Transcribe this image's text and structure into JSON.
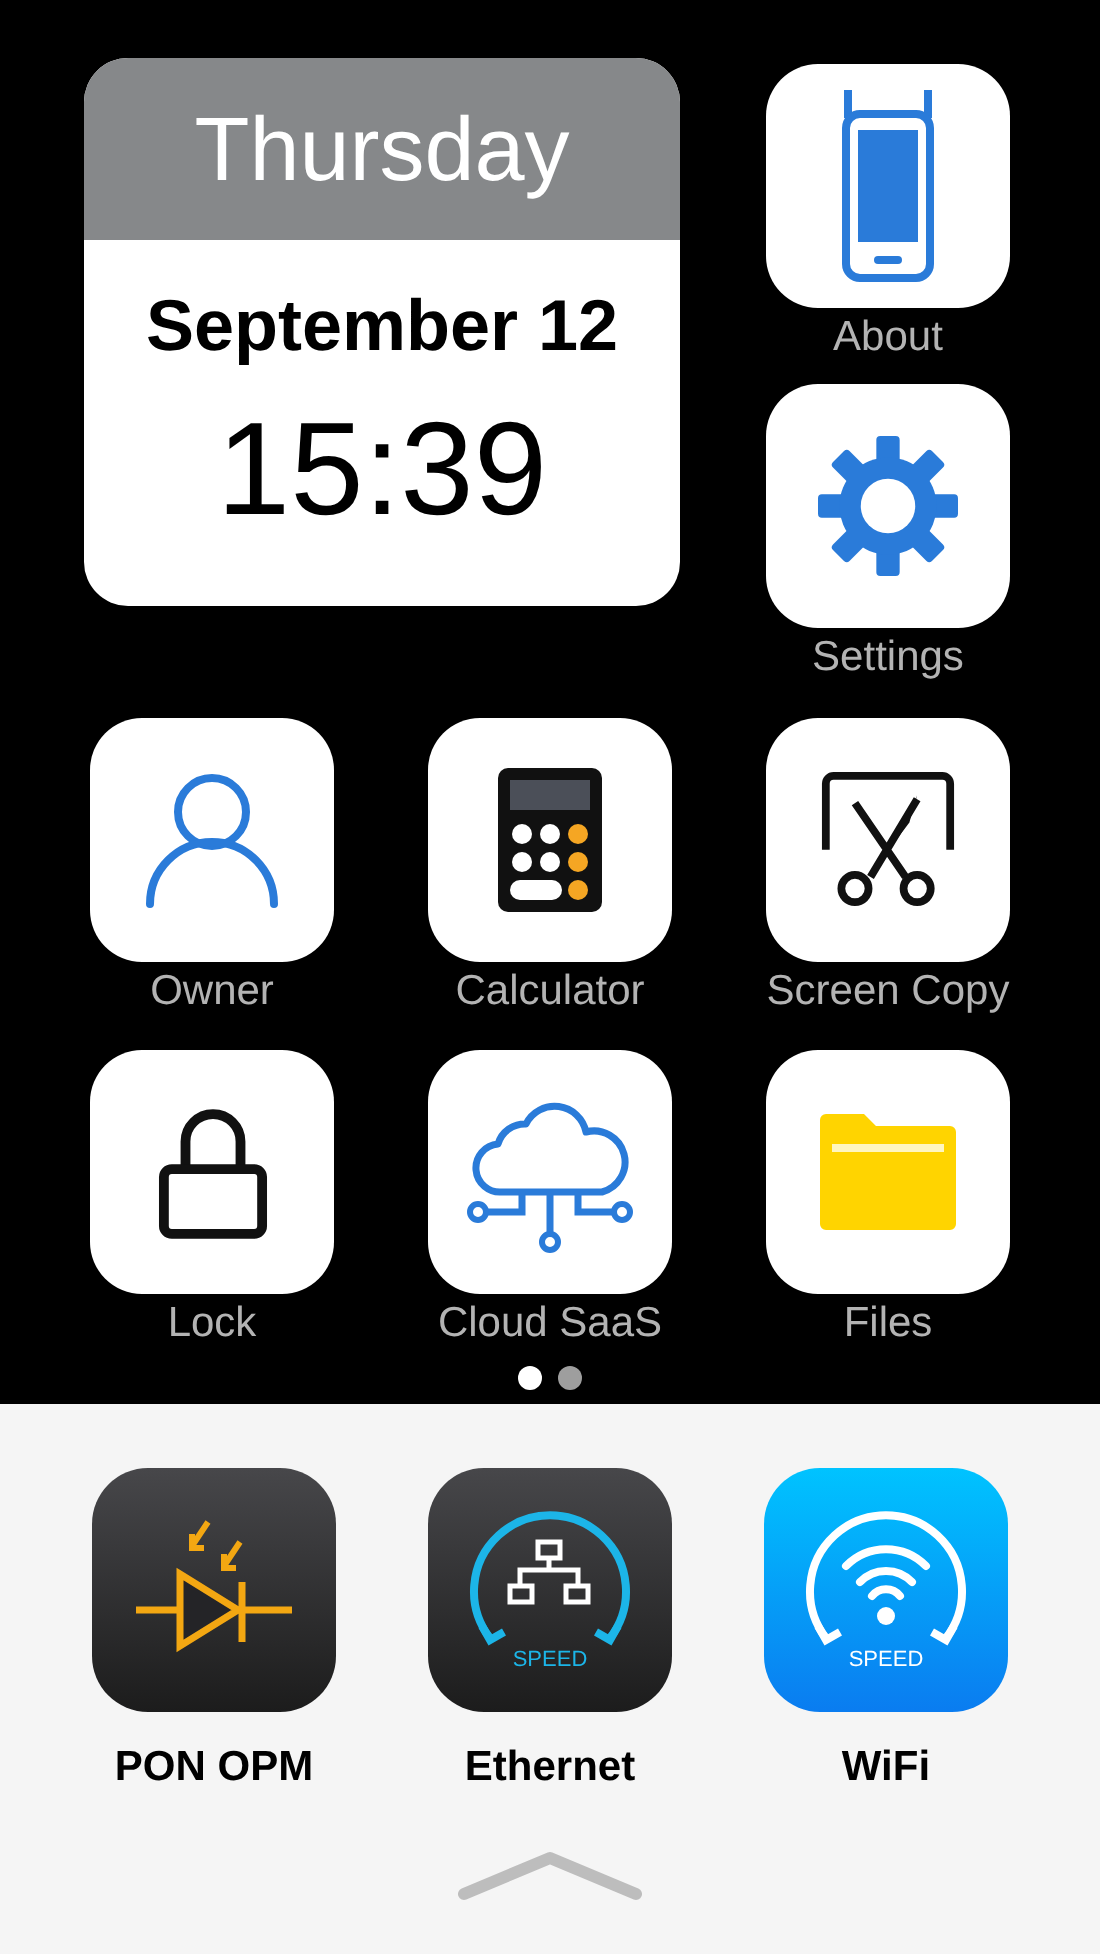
{
  "clock": {
    "weekday": "Thursday",
    "date": "September 12",
    "time": "15:39"
  },
  "side_apps": [
    {
      "label": "About"
    },
    {
      "label": "Settings"
    }
  ],
  "apps": [
    {
      "label": "Owner"
    },
    {
      "label": "Calculator"
    },
    {
      "label": "Screen Copy"
    },
    {
      "label": "Lock"
    },
    {
      "label": "Cloud SaaS"
    },
    {
      "label": "Files"
    }
  ],
  "page_dots": [
    {
      "selected": true
    },
    {
      "selected": false
    }
  ],
  "dock": [
    {
      "label": "PON OPM"
    },
    {
      "label": "Ethernet",
      "badge": "SPEED"
    },
    {
      "label": "WiFi",
      "badge": "SPEED"
    }
  ]
}
